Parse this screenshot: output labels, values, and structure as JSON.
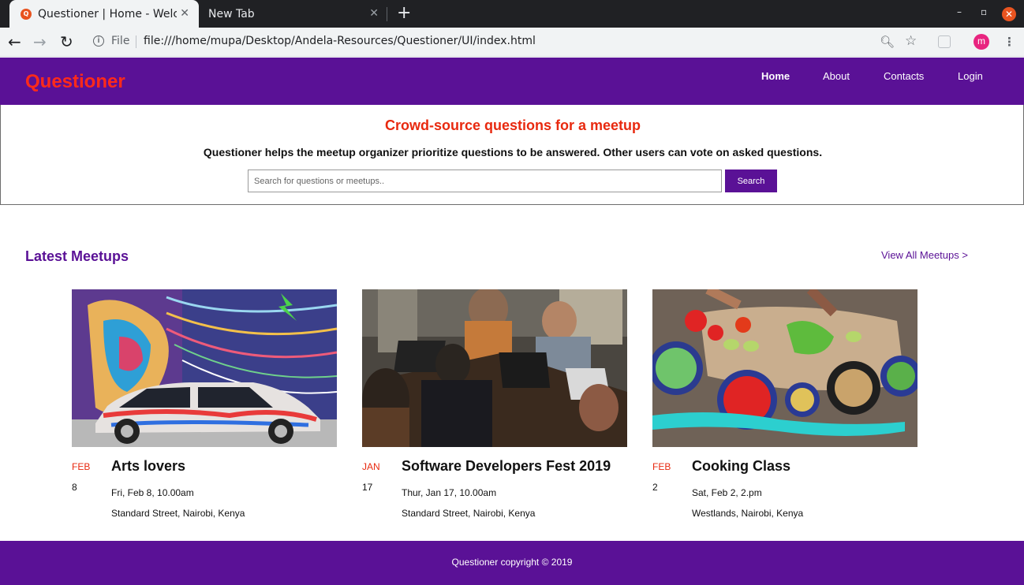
{
  "browser": {
    "tabs": [
      {
        "title": "Questioner | Home - Welcome",
        "favicon": "Q"
      },
      {
        "title": "New Tab"
      }
    ],
    "omnibox": {
      "scheme_label": "File",
      "url": "file:///home/mupa/Desktop/Andela-Resources/Questioner/UI/index.html"
    },
    "profile_initial": "m"
  },
  "site": {
    "brand": "Questioner",
    "nav": [
      "Home",
      "About",
      "Contacts",
      "Login"
    ],
    "active_nav": "Home"
  },
  "hero": {
    "heading": "Crowd-source questions for a meetup",
    "tagline": "Questioner helps the meetup organizer prioritize questions to be answered. Other users can vote on asked questions.",
    "search_placeholder": "Search for questions or meetups..",
    "search_button": "Search"
  },
  "meetups_section": {
    "title": "Latest Meetups",
    "view_all": "View All Meetups >",
    "meetups": [
      {
        "month": "FEB",
        "day": "8",
        "title": "Arts lovers",
        "datetime": "Fri, Feb 8, 10.00am",
        "location": "Standard Street, Nairobi, Kenya",
        "image": "graffiti-car-image"
      },
      {
        "month": "JAN",
        "day": "17",
        "title": "Software Developers Fest 2019",
        "datetime": "Thur, Jan 17, 10.00am",
        "location": "Standard Street, Nairobi, Kenya",
        "image": "developers-laptops-image"
      },
      {
        "month": "FEB",
        "day": "2",
        "title": "Cooking Class",
        "datetime": "Sat, Feb 2, 2.pm",
        "location": "Westlands, Nairobi, Kenya",
        "image": "cooking-vegetables-image"
      }
    ]
  },
  "footer": {
    "text": "Questioner copyright © 2019"
  },
  "colors": {
    "brand_purple": "#5a1196",
    "accent_red": "#e8290f"
  }
}
